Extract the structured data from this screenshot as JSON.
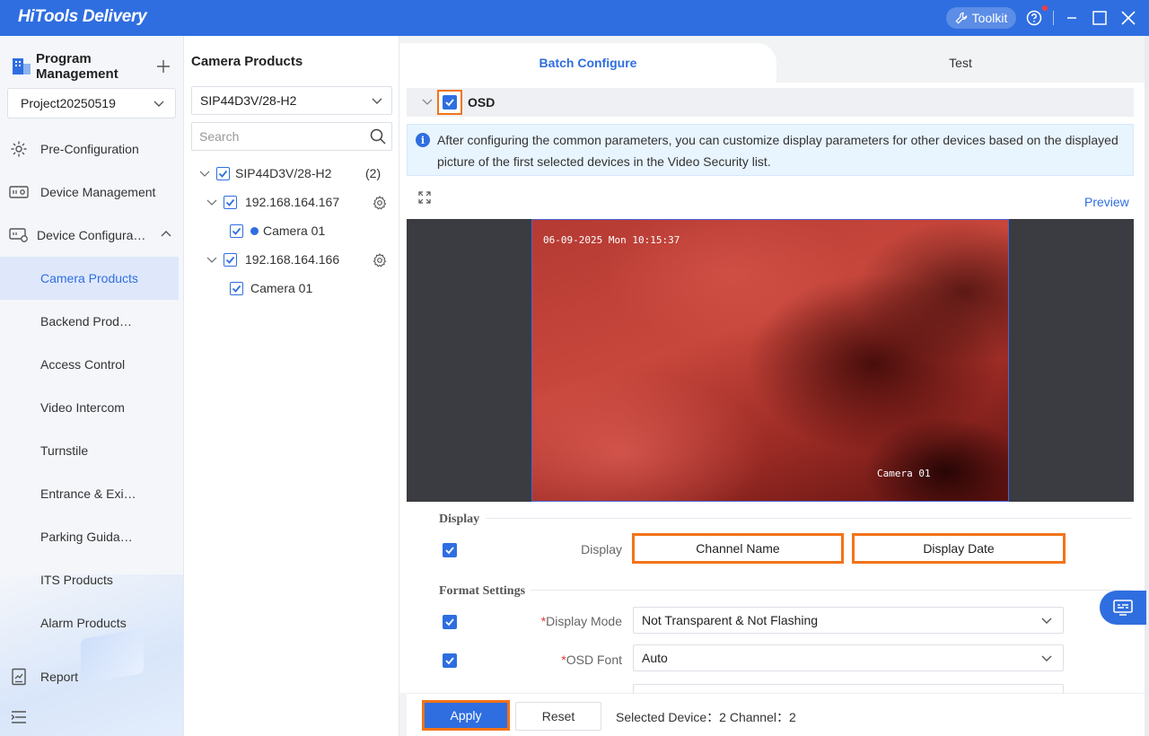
{
  "app": {
    "logo": "HiTools Delivery",
    "toolkit_label": "Toolkit"
  },
  "sidebar": {
    "program_title": "Program Management",
    "project_selected": "Project20250519",
    "items": [
      {
        "label": "Pre-Configuration",
        "icon": "gear-cog-icon"
      },
      {
        "label": "Device Management",
        "icon": "device-icon"
      },
      {
        "label": "Device Configura…",
        "icon": "device-config-icon"
      },
      {
        "label": "Camera Products"
      },
      {
        "label": "Backend Prod…"
      },
      {
        "label": "Access Control"
      },
      {
        "label": "Video Intercom"
      },
      {
        "label": "Turnstile"
      },
      {
        "label": "Entrance & Exi…"
      },
      {
        "label": "Parking Guida…"
      },
      {
        "label": "ITS Products"
      },
      {
        "label": "Alarm Products"
      },
      {
        "label": "Report",
        "icon": "report-icon"
      }
    ]
  },
  "camera_panel": {
    "title": "Camera Products",
    "model_selected": "SIP44D3V/28-H2",
    "search_placeholder": "Search",
    "tree": {
      "root_label": "SIP44D3V/28-H2",
      "root_count": "(2)",
      "devices": [
        {
          "ip": "192.168.164.167",
          "camera": "Camera 01"
        },
        {
          "ip": "192.168.164.166",
          "camera": "Camera 01"
        }
      ]
    }
  },
  "tabs": {
    "active": "Batch Configure",
    "inactive": "Test"
  },
  "osd": {
    "label": "OSD",
    "info": "After configuring the common parameters, you can customize display parameters for other devices based on the displayed picture of the first selected devices in the Video Security list.",
    "preview": "Preview",
    "video_timestamp": "06-09-2025 Mon 10:15:37",
    "video_camera_name": "Camera 01"
  },
  "display_section": {
    "title": "Display",
    "label": "Display",
    "btn1": "Channel Name",
    "btn2": "Display Date"
  },
  "format_section": {
    "title": "Format Settings",
    "req_mark": "*",
    "display_mode_label": "Display Mode",
    "display_mode_value": "Not Transparent & Not Flashing",
    "osd_font_label": "OSD Font",
    "osd_font_value": "Auto"
  },
  "bottom": {
    "apply": "Apply",
    "reset": "Reset",
    "status": "Selected Device：2 Channel：2"
  },
  "colors": {
    "primary": "#2f6ee0",
    "highlight": "#f27318"
  }
}
